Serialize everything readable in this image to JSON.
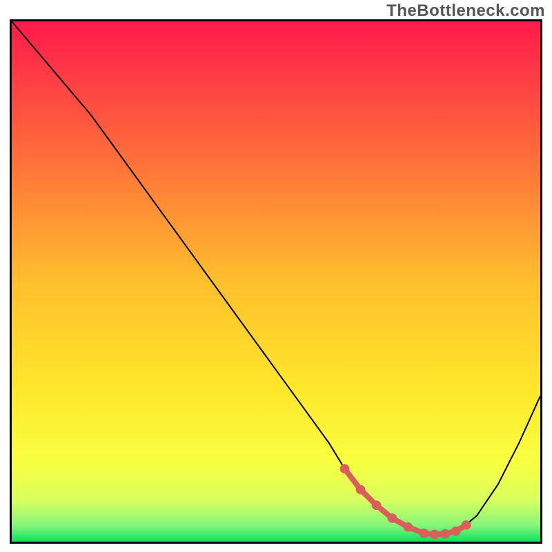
{
  "watermark": "TheBottleneck.com",
  "chart_data": {
    "type": "line",
    "title": "",
    "xlabel": "",
    "ylabel": "",
    "xlim": [
      0,
      100
    ],
    "ylim": [
      0,
      100
    ],
    "grid": false,
    "legend": false,
    "background_gradient": {
      "stops": [
        {
          "offset": 0.0,
          "color": "#ff1a4b"
        },
        {
          "offset": 0.25,
          "color": "#ff6a3a"
        },
        {
          "offset": 0.5,
          "color": "#ffbf2d"
        },
        {
          "offset": 0.7,
          "color": "#ffe62a"
        },
        {
          "offset": 0.85,
          "color": "#f8ff40"
        },
        {
          "offset": 0.92,
          "color": "#d9ff5e"
        },
        {
          "offset": 0.97,
          "color": "#82f57a"
        },
        {
          "offset": 1.0,
          "color": "#0be060"
        }
      ]
    },
    "series": [
      {
        "name": "bottleneck-curve",
        "color": "#000000",
        "width": 2,
        "x": [
          0,
          5,
          10,
          15,
          20,
          25,
          30,
          35,
          40,
          45,
          50,
          55,
          60,
          63,
          66,
          70,
          74,
          78,
          82,
          85,
          88,
          92,
          96,
          100
        ],
        "y": [
          100,
          94,
          88,
          82,
          75,
          68,
          61,
          54,
          47,
          40,
          33,
          26,
          19,
          14,
          10,
          6,
          3,
          1.5,
          1.5,
          2.5,
          5,
          11,
          19,
          28
        ]
      }
    ],
    "highlight_segment": {
      "name": "optimal-zone",
      "color": "#d8605a",
      "width": 8,
      "dots": true,
      "x": [
        63,
        66,
        69,
        72,
        75,
        78,
        80,
        82,
        84,
        86
      ],
      "y": [
        14,
        10,
        7,
        4.5,
        2.8,
        1.6,
        1.4,
        1.5,
        2.0,
        3.2
      ]
    }
  }
}
